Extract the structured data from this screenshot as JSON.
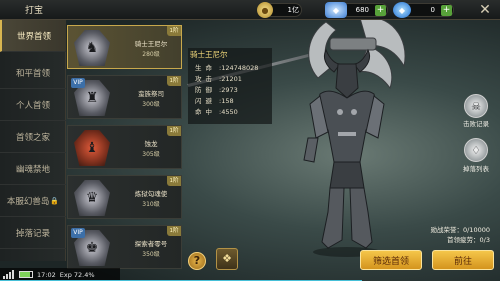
{
  "header": {
    "title": "打宝",
    "gold_value": "1亿",
    "diamond_value": "680",
    "bound_diamond_value": "0",
    "gold_icon": "gold-coin-icon",
    "diamond_icon": "diamond-icon",
    "bound_diamond_icon": "bound-diamond-icon"
  },
  "nav": {
    "items": [
      {
        "label": "世界首领",
        "active": true
      },
      {
        "label": "和平首领"
      },
      {
        "label": "个人首领"
      },
      {
        "label": "首领之家"
      },
      {
        "label": "幽魂禁地"
      },
      {
        "label": "本服幻兽岛",
        "locked": true
      },
      {
        "label": "掉落记录"
      }
    ]
  },
  "boss_list": [
    {
      "name": "骑士王尼尔",
      "level": "280级",
      "corner": "1阶",
      "active": true
    },
    {
      "name": "蛮族祭司",
      "level": "300级",
      "corner": "1阶",
      "tag": "VIP"
    },
    {
      "name": "蚀龙",
      "level": "305级",
      "corner": "1阶"
    },
    {
      "name": "炼狱勾魂使",
      "level": "310级",
      "corner": "1阶"
    },
    {
      "name": "探索者零号",
      "level": "350级",
      "corner": "1阶",
      "tag": "VIP"
    }
  ],
  "info": {
    "title": "骑士王尼尔",
    "rows": [
      {
        "key": "生命",
        "value": "124748028"
      },
      {
        "key": "攻击",
        "value": "21201"
      },
      {
        "key": "防御",
        "value": "2973"
      },
      {
        "key": "闪避",
        "value": "158"
      },
      {
        "key": "命中",
        "value": "4550"
      }
    ]
  },
  "side": {
    "kill_record": "击败记录",
    "drop_list": "掉落列表"
  },
  "stats": {
    "honor": "勋战荣誉：0/10000",
    "fatigue": "首领疲劳：0/3"
  },
  "buttons": {
    "filter": "筛选首领",
    "goto": "前往",
    "help": "?"
  },
  "status": {
    "time": "17:02",
    "exp": "Exp  72.4%",
    "exp_progress": 0.724
  },
  "colors": {
    "accent_gold": "#d4941d",
    "active_nav": "#4a4637",
    "info_title": "#f2d87a"
  }
}
